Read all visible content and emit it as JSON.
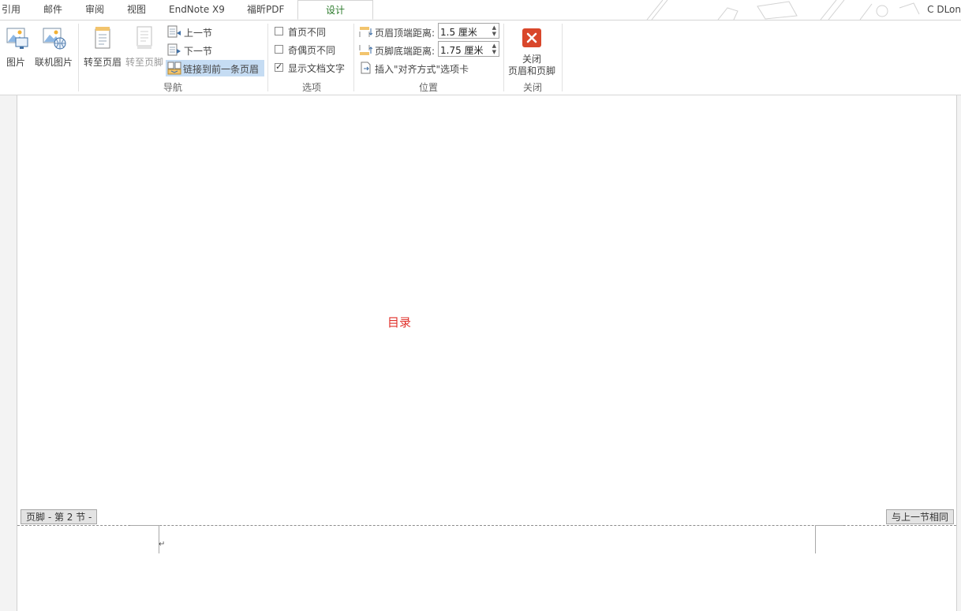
{
  "tabs": [
    {
      "label": "引用"
    },
    {
      "label": "邮件"
    },
    {
      "label": "审阅"
    },
    {
      "label": "视图"
    },
    {
      "label": "EndNote X9"
    },
    {
      "label": "福昕PDF"
    },
    {
      "label": "设计",
      "active": true
    }
  ],
  "user": {
    "name": "C DLon"
  },
  "ribbon": {
    "insert": {
      "picture": "图片",
      "online_picture": "联机图片"
    },
    "navigation": {
      "goto_header": "转至页眉",
      "goto_footer": "转至页脚",
      "previous_section": "上一节",
      "next_section": "下一节",
      "link_to_previous": "链接到前一条页眉",
      "group_label": "导航"
    },
    "options": {
      "different_first_page": "首页不同",
      "different_odd_even": "奇偶页不同",
      "show_document_text": "显示文档文字",
      "checked": {
        "different_first_page": false,
        "different_odd_even": false,
        "show_document_text": true
      },
      "group_label": "选项"
    },
    "position": {
      "header_from_top_label": "页眉顶端距离:",
      "header_from_top_value": "1.5 厘米",
      "footer_from_bottom_label": "页脚底端距离:",
      "footer_from_bottom_value": "1.75 厘米",
      "insert_alignment_tab": "插入\"对齐方式\"选项卡",
      "group_label": "位置"
    },
    "close": {
      "button_line1": "关闭",
      "button_line2": "页眉和页脚",
      "group_label": "关闭"
    }
  },
  "document": {
    "toc_heading": "目录",
    "footer_tag": "页脚 - 第 2 节 -",
    "same_as_previous": "与上一节相同",
    "paragraph_mark": "↵"
  },
  "colors": {
    "active_tab_text": "#2b7a2b",
    "close_icon": "#d9472b",
    "toc_heading": "#e0302a",
    "highlight": "#c5dcf3"
  }
}
